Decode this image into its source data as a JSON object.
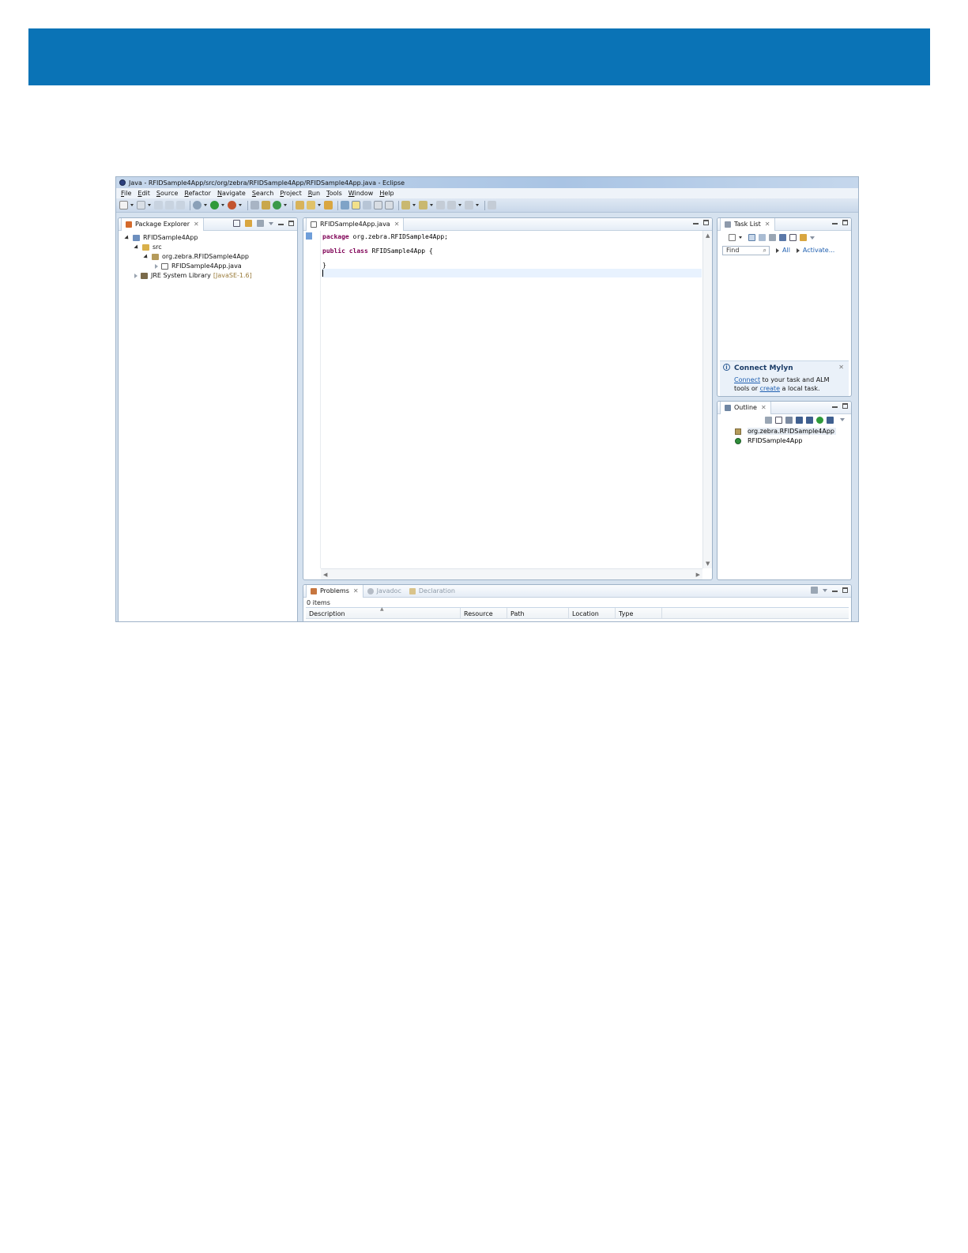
{
  "window": {
    "title": "Java - RFIDSample4App/src/org/zebra/RFIDSample4App/RFIDSample4App.java - Eclipse"
  },
  "menu": [
    "File",
    "Edit",
    "Source",
    "Refactor",
    "Navigate",
    "Search",
    "Project",
    "Run",
    "Tools",
    "Window",
    "Help"
  ],
  "package_explorer": {
    "tab_label": "Package Explorer",
    "project": "RFIDSample4App",
    "src": "src",
    "package": "org.zebra.RFIDSample4App",
    "file": "RFIDSample4App.java",
    "library": "JRE System Library",
    "library_version": "[JavaSE-1.6]"
  },
  "editor": {
    "tab_label": "RFIDSample4App.java",
    "lines": {
      "l1_kw": "package",
      "l1_rest": " org.zebra.RFIDSample4App;",
      "l2_kw1": "public",
      "l2_kw2": "class",
      "l2_rest": " RFIDSample4App {",
      "l3": "}"
    }
  },
  "task_list": {
    "tab_label": "Task List",
    "find_placeholder": "Find",
    "all_link": "All",
    "activate_link": "Activate..."
  },
  "mylyn": {
    "title": "Connect Mylyn",
    "connect_link": "Connect",
    "text_1": " to your task and ALM tools or",
    "create_link": "create",
    "text_2": " a local task."
  },
  "outline": {
    "tab_label": "Outline",
    "package_item": "org.zebra.RFIDSample4App",
    "class_item": "RFIDSample4App"
  },
  "bottom_panel": {
    "tabs": {
      "problems": "Problems",
      "javadoc": "Javadoc",
      "declaration": "Declaration"
    },
    "count": "0 items",
    "columns": [
      "Description",
      "Resource",
      "Path",
      "Location",
      "Type"
    ]
  },
  "colors": {
    "banner": "#0a73b6",
    "keyword": "#7f0055",
    "link": "#1f5fb0"
  }
}
